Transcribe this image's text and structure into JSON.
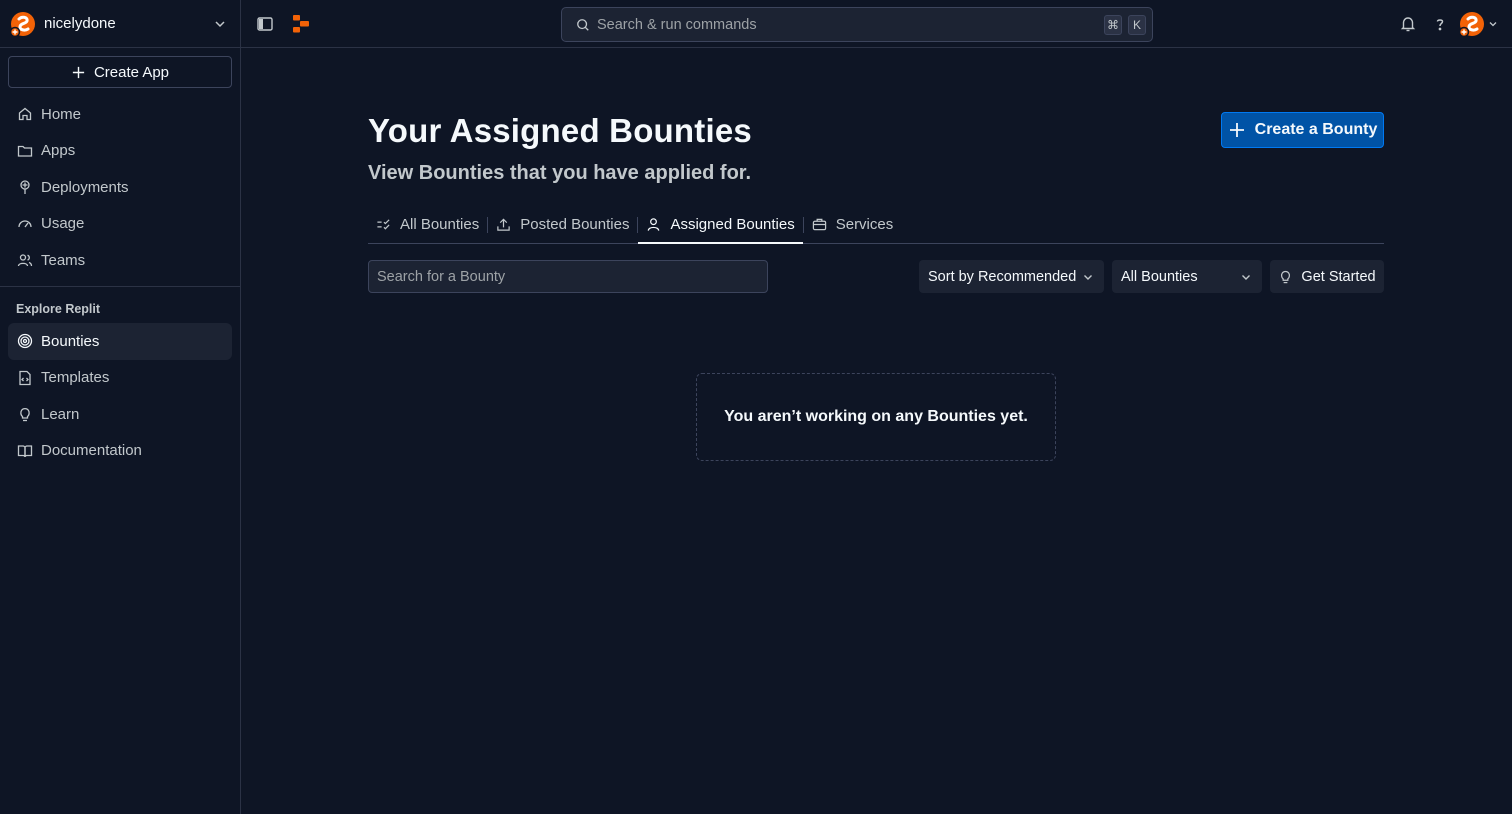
{
  "workspace": {
    "name": "nicelydone"
  },
  "sidebar": {
    "create_app_label": "Create App",
    "primary_items": [
      {
        "label": "Home",
        "icon": "home-icon"
      },
      {
        "label": "Apps",
        "icon": "folder-icon"
      },
      {
        "label": "Deployments",
        "icon": "deployments-icon"
      },
      {
        "label": "Usage",
        "icon": "gauge-icon"
      },
      {
        "label": "Teams",
        "icon": "users-icon"
      }
    ],
    "explore_title": "Explore Replit",
    "explore_items": [
      {
        "label": "Bounties",
        "icon": "bounties-icon",
        "active": true
      },
      {
        "label": "Templates",
        "icon": "template-icon"
      },
      {
        "label": "Learn",
        "icon": "lightbulb-icon"
      },
      {
        "label": "Documentation",
        "icon": "book-icon"
      }
    ]
  },
  "topbar": {
    "search_placeholder": "Search & run commands",
    "shortcut_keys": [
      "⌘",
      "K"
    ]
  },
  "main": {
    "title": "Your Assigned Bounties",
    "subtitle": "View Bounties that you have applied for.",
    "create_bounty_label": "Create a Bounty",
    "tabs": [
      {
        "label": "All Bounties",
        "icon": "checklist-icon"
      },
      {
        "label": "Posted Bounties",
        "icon": "upload-icon"
      },
      {
        "label": "Assigned Bounties",
        "icon": "user-icon",
        "active": true
      },
      {
        "label": "Services",
        "icon": "briefcase-icon"
      }
    ],
    "search_placeholder": "Search for a Bounty",
    "sort_label": "Sort by Recommended",
    "filter_label": "All Bounties",
    "get_started_label": "Get Started",
    "empty_message": "You aren’t working on any Bounties yet."
  },
  "colors": {
    "background": "#0e1525",
    "surface": "#1c2333",
    "border": "#3c445c",
    "primary_button": "#0053a6",
    "brand_orange": "#f26207"
  }
}
